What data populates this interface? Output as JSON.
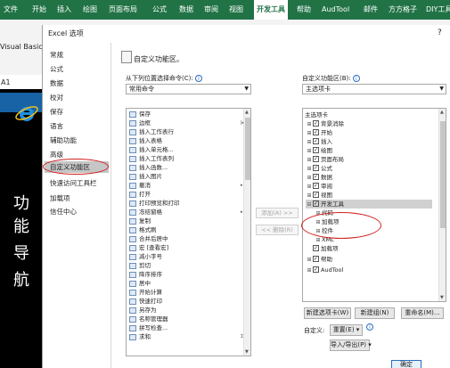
{
  "ribbon": {
    "tabs": [
      "文件",
      "开始",
      "插入",
      "绘图",
      "页面布局",
      "公式",
      "数据",
      "审阅",
      "视图",
      "开发工具",
      "帮助",
      "AudTool",
      "邮件",
      "方方格子",
      "DIY工具"
    ],
    "active_tab": "开发工具",
    "visual_basic_label": "Visual Basic"
  },
  "sheet": {
    "name_box": "A1",
    "vertical_text": [
      "功",
      "能",
      "导",
      "航"
    ]
  },
  "dialog": {
    "title": "Excel 选项",
    "help": "?",
    "categories": [
      "常规",
      "公式",
      "数据",
      "校对",
      "保存",
      "语言",
      "辅助功能",
      "高级",
      "自定义功能区",
      "快速访问工具栏",
      "加载项",
      "信任中心"
    ],
    "selected_category": "自定义功能区",
    "main_title": "自定义功能区。",
    "choose_from_label": "从下列位置选择命令(C):",
    "choose_from_value": "常用命令",
    "customize_label": "自定义功能区(B):",
    "customize_value": "主选项卡",
    "commands": [
      {
        "label": "保存",
        "sub": ""
      },
      {
        "label": "边框",
        "sub": "|▸"
      },
      {
        "label": "插入工作表行",
        "sub": ""
      },
      {
        "label": "插入表格",
        "sub": ""
      },
      {
        "label": "插入单元格...",
        "sub": ""
      },
      {
        "label": "插入工作表列",
        "sub": ""
      },
      {
        "label": "插入函数...",
        "sub": ""
      },
      {
        "label": "插入图片",
        "sub": ""
      },
      {
        "label": "撤消",
        "sub": "▸"
      },
      {
        "label": "打开",
        "sub": ""
      },
      {
        "label": "打印预览和打印",
        "sub": ""
      },
      {
        "label": "冻结窗格",
        "sub": "▸"
      },
      {
        "label": "复制",
        "sub": ""
      },
      {
        "label": "格式刷",
        "sub": ""
      },
      {
        "label": "合并后居中",
        "sub": ""
      },
      {
        "label": "宏 [查看宏]",
        "sub": ""
      },
      {
        "label": "减小字号",
        "sub": ""
      },
      {
        "label": "剪切",
        "sub": ""
      },
      {
        "label": "降序排序",
        "sub": ""
      },
      {
        "label": "居中",
        "sub": ""
      },
      {
        "label": "开始计算",
        "sub": ""
      },
      {
        "label": "快速打印",
        "sub": ""
      },
      {
        "label": "另存为",
        "sub": ""
      },
      {
        "label": "名称管理器",
        "sub": ""
      },
      {
        "label": "拼写检查...",
        "sub": ""
      },
      {
        "label": "求和",
        "sub": "Σ"
      }
    ],
    "add_button": "添加(A) >>",
    "remove_button": "<< 删除(R)",
    "tree_header": "主选项卡",
    "tree": [
      {
        "label": "背景消除",
        "exp": "⊞",
        "checked": true,
        "indent": 1
      },
      {
        "label": "开始",
        "exp": "⊞",
        "checked": true,
        "indent": 1
      },
      {
        "label": "插入",
        "exp": "⊞",
        "checked": true,
        "indent": 1
      },
      {
        "label": "绘图",
        "exp": "⊞",
        "checked": true,
        "indent": 1
      },
      {
        "label": "页面布局",
        "exp": "⊞",
        "checked": true,
        "indent": 1
      },
      {
        "label": "公式",
        "exp": "⊞",
        "checked": true,
        "indent": 1
      },
      {
        "label": "数据",
        "exp": "⊞",
        "checked": true,
        "indent": 1
      },
      {
        "label": "审阅",
        "exp": "⊞",
        "checked": true,
        "indent": 1
      },
      {
        "label": "视图",
        "exp": "⊞",
        "checked": true,
        "indent": 1
      },
      {
        "label": "开发工具",
        "exp": "⊟",
        "checked": true,
        "indent": 1,
        "highlight": true
      },
      {
        "label": "代码",
        "exp": "⊞",
        "checked": null,
        "indent": 2
      },
      {
        "label": "加载项",
        "exp": "⊞",
        "checked": null,
        "indent": 2
      },
      {
        "label": "控件",
        "exp": "⊞",
        "checked": null,
        "indent": 2
      },
      {
        "label": "XML",
        "exp": "⊞",
        "checked": null,
        "indent": 2
      },
      {
        "label": "加载项",
        "exp": "",
        "checked": true,
        "indent": 1
      },
      {
        "label": "帮助",
        "exp": "⊞",
        "checked": true,
        "indent": 1
      },
      {
        "label": "AudTool",
        "exp": "⊞",
        "checked": true,
        "indent": 1
      }
    ],
    "new_tab_button": "新建选项卡(W)",
    "new_group_button": "新建组(N)",
    "rename_button": "重命名(M)...",
    "customizations_label": "自定义:",
    "reset_button": "重置(E) ▾",
    "import_export_button": "导入/导出(P) ▾",
    "ok_button": "确定"
  },
  "colors": {
    "ribbon_green": "#217346",
    "annotation_red": "#d02020",
    "selected_gray": "#c6c6c6"
  }
}
